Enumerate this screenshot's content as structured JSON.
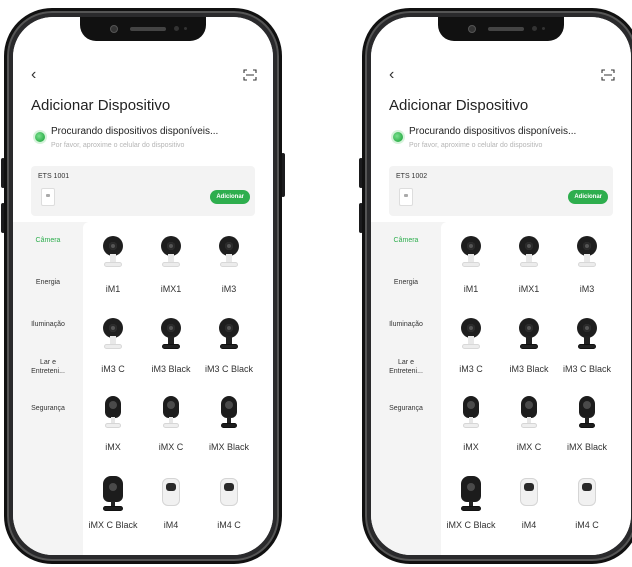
{
  "screens": [
    {
      "title": "Adicionar Dispositivo",
      "searching": {
        "title": "Procurando dispositivos disponíveis...",
        "hint": "Por favor, aproxime o celular do dispositivo"
      },
      "found_device": {
        "name": "ETS 1001",
        "add_label": "Adicionar"
      },
      "categories": [
        "Câmera",
        "Energia",
        "Iluminação",
        "Lar e Entreteni...",
        "Segurança"
      ],
      "active_category": "Câmera",
      "devices": [
        "iM1",
        "iMX1",
        "iM3",
        "iM3 C",
        "iM3 Black",
        "iM3 C Black",
        "iMX",
        "iMX C",
        "iMX Black",
        "iMX C Black",
        "iM4",
        "iM4 C"
      ]
    },
    {
      "title": "Adicionar Dispositivo",
      "searching": {
        "title": "Procurando dispositivos disponíveis...",
        "hint": "Por favor, aproxime o celular do dispositivo"
      },
      "found_device": {
        "name": "ETS 1002",
        "add_label": "Adicionar"
      },
      "categories": [
        "Câmera",
        "Energia",
        "Iluminação",
        "Lar e Entreteni...",
        "Segurança"
      ],
      "active_category": "Câmera",
      "devices": [
        "iM1",
        "iMX1",
        "iM3",
        "iM3 C",
        "iM3 Black",
        "iM3 C Black",
        "iMX",
        "iMX C",
        "iMX Black",
        "iMX C Black",
        "iM4",
        "iM4 C"
      ]
    }
  ],
  "colors": {
    "accent": "#2eae4e",
    "hint": "#b5b5b5",
    "panel": "#f4f4f4"
  },
  "icons": {
    "back": "chevron-left-icon",
    "scan": "scan-icon",
    "searching": "searching-dot-icon"
  }
}
